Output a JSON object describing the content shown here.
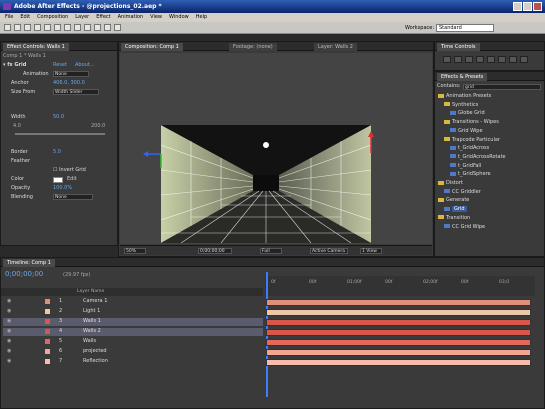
{
  "app": {
    "title": "Adobe After Effects - @projections_02.aep *"
  },
  "menu": [
    "File",
    "Edit",
    "Composition",
    "Layer",
    "Effect",
    "Animation",
    "View",
    "Window",
    "Help"
  ],
  "toolbar": {
    "workspace_label": "Workspace:",
    "workspace_value": "Standard"
  },
  "effect_controls": {
    "tab": "Effect Controls: Walls 1",
    "layer_path": "Comp 1 * Walls 1",
    "effect_name": "Grid",
    "reset_label": "Reset",
    "about_label": "About...",
    "params": [
      {
        "name": "Anchor",
        "value": "406.0, 300.0"
      },
      {
        "name": "Size From",
        "value": "Width Slider"
      },
      {
        "name": "Width",
        "value": "50.0"
      },
      {
        "name": "Border",
        "value": "5.0"
      },
      {
        "name": "Feather",
        "value": ""
      },
      {
        "name": "Invert Grid",
        "value": ""
      },
      {
        "name": "Color",
        "value": "Edit"
      },
      {
        "name": "Opacity",
        "value": "100.0%"
      },
      {
        "name": "Blending",
        "value": "None"
      }
    ],
    "animation_label": "Animation",
    "animation_value": "None",
    "slider_range": {
      "min": "4.0",
      "max": "200.0"
    }
  },
  "comp_viewer": {
    "tabs": [
      "Composition: Comp 1",
      "Footage: (none)",
      "Layer: Walls 2"
    ],
    "zoom": "50%",
    "time": "0;00;00;00",
    "resolution": "Full",
    "camera": "Active Camera",
    "views": "1 View"
  },
  "time_controls": {
    "tab": "Time Controls"
  },
  "effects_presets": {
    "tab": "Effects & Presets",
    "search_label": "Contains:",
    "search_value": "grid",
    "tree": [
      {
        "label": "Animation Presets",
        "level": 0,
        "kind": "folder"
      },
      {
        "label": "Synthetics",
        "level": 1,
        "kind": "folder"
      },
      {
        "label": "Globe Grid",
        "level": 2,
        "kind": "fx"
      },
      {
        "label": "Transitions - Wipes",
        "level": 1,
        "kind": "folder"
      },
      {
        "label": "Grid Wipe",
        "level": 2,
        "kind": "fx"
      },
      {
        "label": "Trapcode Particular",
        "level": 1,
        "kind": "folder"
      },
      {
        "label": "t_GridAcross",
        "level": 2,
        "kind": "fx"
      },
      {
        "label": "t_GridAcrossRotate",
        "level": 2,
        "kind": "fx"
      },
      {
        "label": "t_GridFall",
        "level": 2,
        "kind": "fx"
      },
      {
        "label": "t_GridSphere",
        "level": 2,
        "kind": "fx"
      },
      {
        "label": "Distort",
        "level": 0,
        "kind": "folder"
      },
      {
        "label": "CC Griddler",
        "level": 1,
        "kind": "fx"
      },
      {
        "label": "Generate",
        "level": 0,
        "kind": "folder"
      },
      {
        "label": "Grid",
        "level": 1,
        "kind": "fx",
        "selected": true
      },
      {
        "label": "Transition",
        "level": 0,
        "kind": "folder"
      },
      {
        "label": "CC Grid Wipe",
        "level": 1,
        "kind": "fx"
      }
    ]
  },
  "timeline": {
    "tab": "Timeline: Comp 1",
    "timecode": "0;00;00;00",
    "fps": "(29.97 fps)",
    "column_header": "Layer Name",
    "ruler_labels": [
      "0f",
      "00f",
      "01;00f",
      "00f",
      "02;00f",
      "00f",
      "03;0"
    ],
    "layers": [
      {
        "num": "1",
        "name": "Camera 1",
        "color": "#e08f7a"
      },
      {
        "num": "2",
        "name": "Light 1",
        "color": "#eec7a8"
      },
      {
        "num": "3",
        "name": "Walls 1",
        "color": "#d9574a",
        "selected": true
      },
      {
        "num": "4",
        "name": "Walls 2",
        "color": "#d9574a",
        "selected": true
      },
      {
        "num": "5",
        "name": "Walls",
        "color": "#e1685a"
      },
      {
        "num": "6",
        "name": "projected",
        "color": "#f1a592"
      },
      {
        "num": "7",
        "name": "Reflection",
        "color": "#f6bcae"
      }
    ]
  }
}
